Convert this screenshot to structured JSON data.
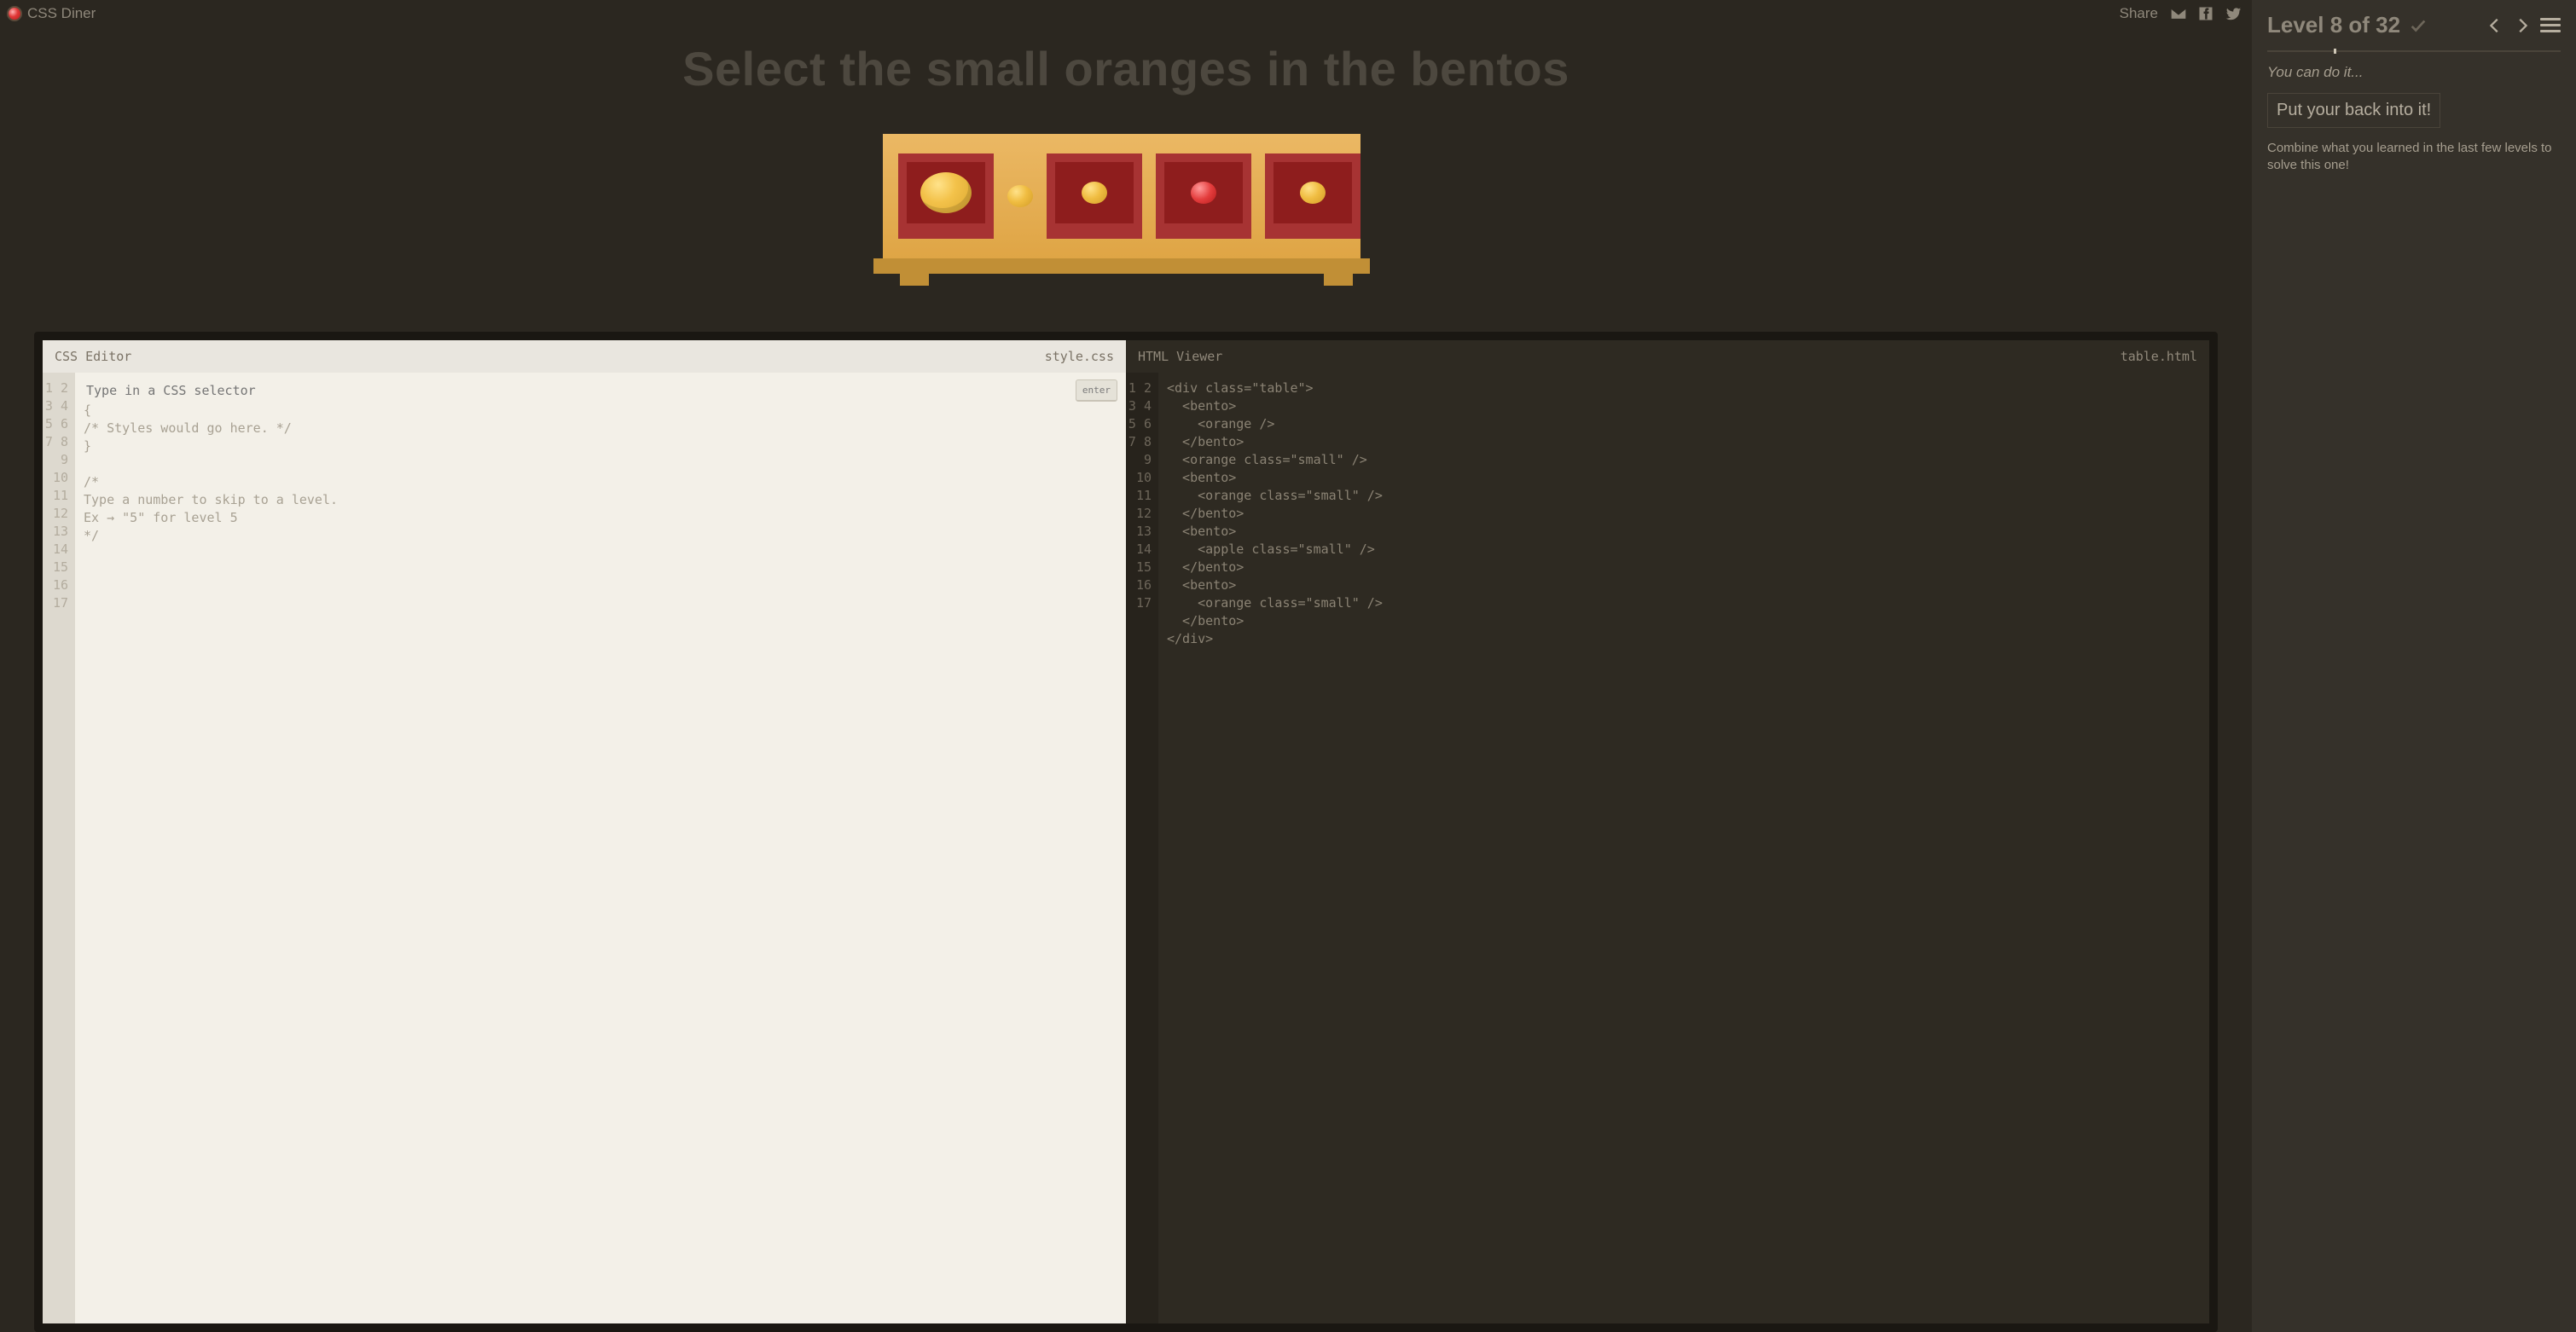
{
  "brand": "CSS Diner",
  "share_label": "Share",
  "task_title": "Select the small oranges in the bentos",
  "css_editor": {
    "title": "CSS Editor",
    "filename": "style.css",
    "placeholder": "Type in a CSS selector",
    "enter_label": "enter",
    "lines": [
      "",
      "{",
      "/* Styles would go here. */",
      "}",
      "",
      "/*",
      "Type a number to skip to a level.",
      "Ex → \"5\" for level 5",
      "*/"
    ],
    "max_lines": 17
  },
  "html_viewer": {
    "title": "HTML Viewer",
    "filename": "table.html",
    "lines": [
      "<div class=\"table\">",
      "  <bento>",
      "    <orange />",
      "  </bento>",
      "  <orange class=\"small\" />",
      "  <bento>",
      "    <orange class=\"small\" />",
      "  </bento>",
      "  <bento>",
      "    <apple class=\"small\" />",
      "  </bento>",
      "  <bento>",
      "    <orange class=\"small\" />",
      "  </bento>",
      "</div>"
    ],
    "max_lines": 17
  },
  "sidebar": {
    "level_label": "Level 8 of 32",
    "current_level": 8,
    "total_levels": 32,
    "encourage": "You can do it...",
    "subtitle": "Put your back into it!",
    "hint": "Combine what you learned in the last few levels to solve this one!"
  }
}
